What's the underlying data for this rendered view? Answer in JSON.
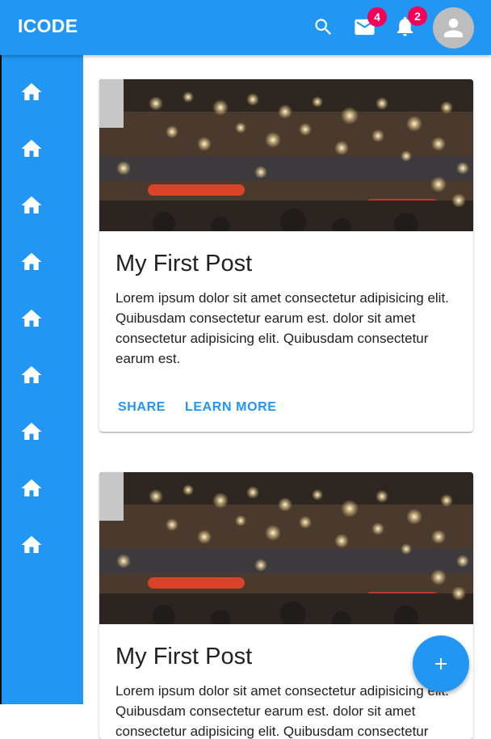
{
  "appbar": {
    "brand": "ICODE",
    "mail_badge": "4",
    "notifications_badge": "2"
  },
  "sidebar": {
    "items": [
      {
        "icon": "home-icon"
      },
      {
        "icon": "home-icon"
      },
      {
        "icon": "home-icon"
      },
      {
        "icon": "home-icon"
      },
      {
        "icon": "home-icon"
      },
      {
        "icon": "home-icon"
      },
      {
        "icon": "home-icon"
      },
      {
        "icon": "home-icon"
      },
      {
        "icon": "home-icon"
      }
    ]
  },
  "posts": [
    {
      "title": "My First Post",
      "text": "Lorem ipsum dolor sit amet consectetur adipisicing elit. Quibusdam consectetur earum est. dolor sit amet consectetur adipisicing elit. Quibusdam consectetur earum est.",
      "share_label": "SHARE",
      "learn_more_label": "LEARN MORE"
    },
    {
      "title": "My First Post",
      "text": "Lorem ipsum dolor sit amet consectetur adipisicing elit. Quibusdam consectetur earum est. dolor sit amet consectetur adipisicing elit. Quibusdam consectetur earum est."
    }
  ],
  "fab": {
    "icon": "add-icon"
  },
  "colors": {
    "primary": "#2196f3",
    "badge": "#f50057",
    "avatar_bg": "#bdbdbd"
  }
}
